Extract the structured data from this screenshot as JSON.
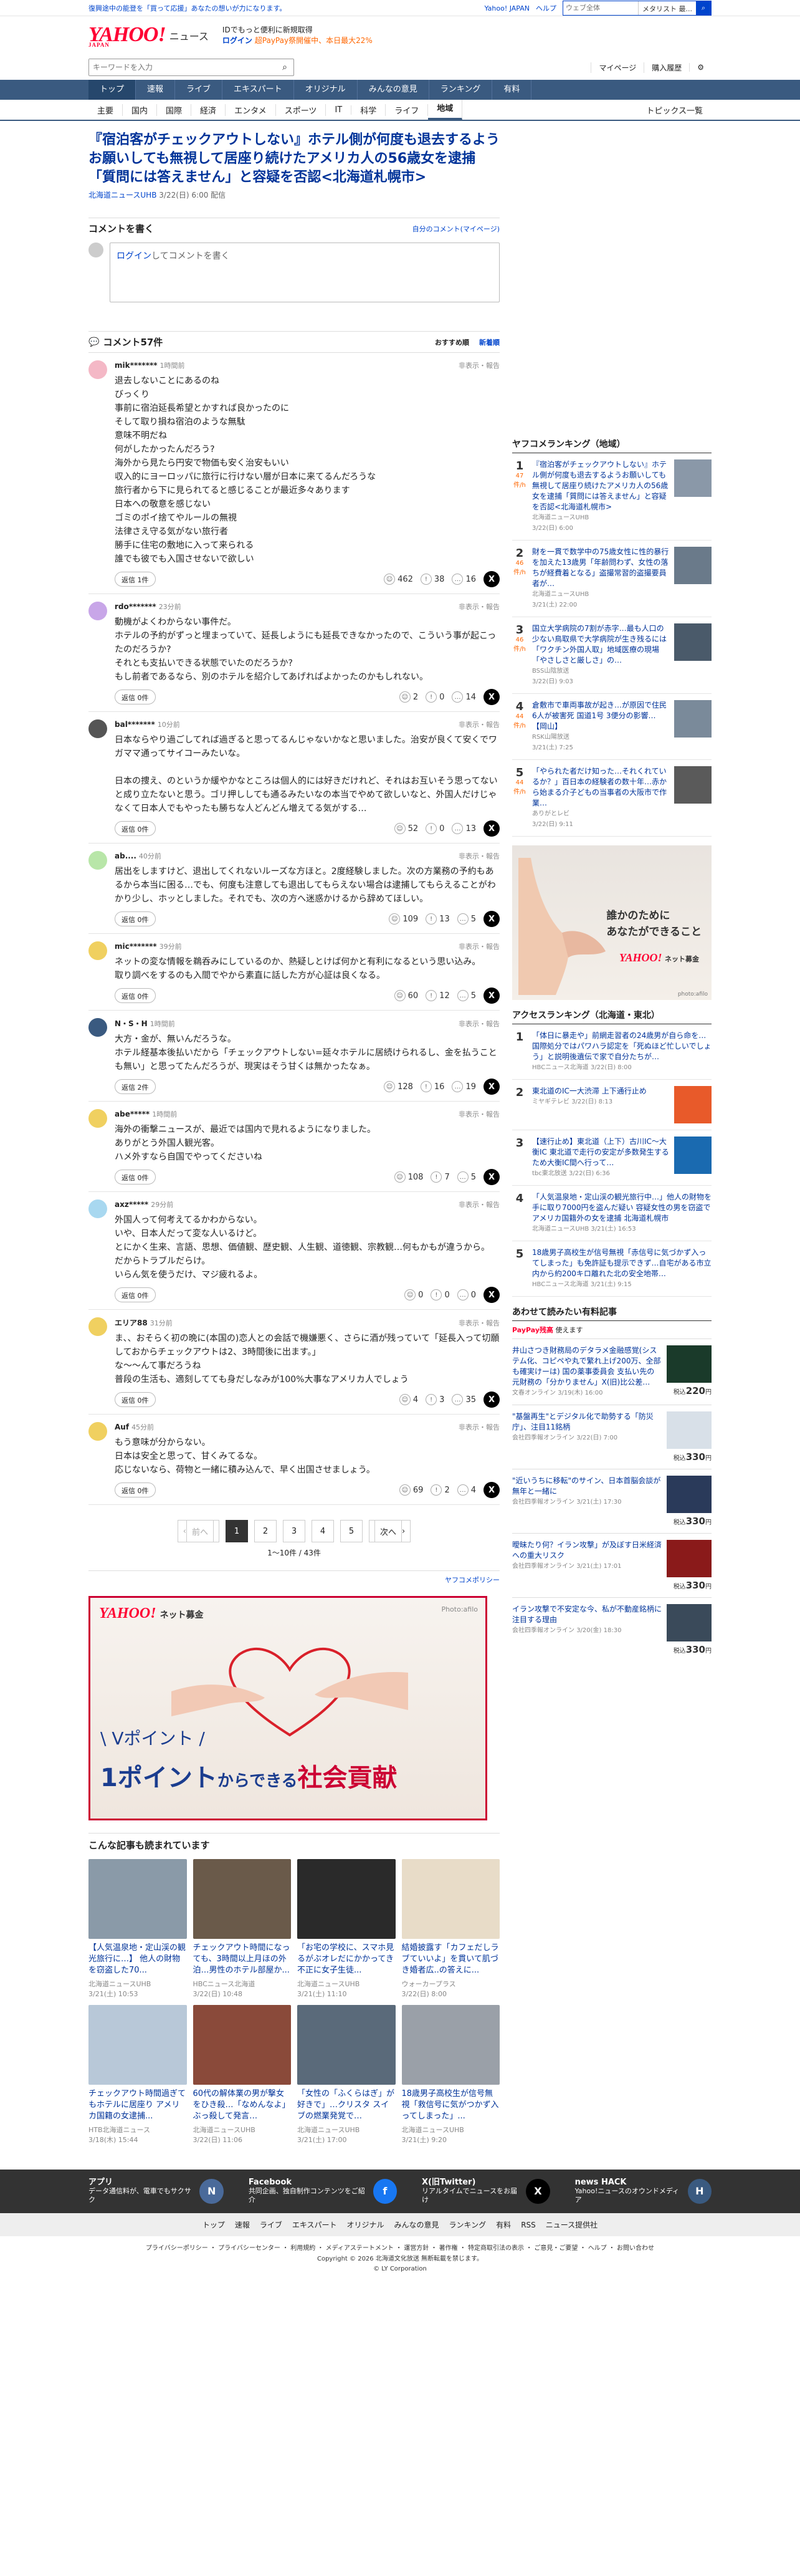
{
  "topbar": {
    "left": "復興途中の能登を「買って応援」あなたの想いが力になります。",
    "right_links": [
      "Yahoo! JAPAN",
      "ヘルプ"
    ],
    "search_placeholder": "キーワードを入力",
    "search_option": "ウェブ全体",
    "search_option2": "メタリスト 最..."
  },
  "header": {
    "logo": "YAHOO!",
    "logo_sub": "JAPAN",
    "service": "ニュース",
    "promo_line1": "IDでもっと便利に新規取得",
    "promo_line2": "ログイン",
    "promo_line3": "超PayPay祭開催中、本日最大22%"
  },
  "search": {
    "placeholder": "キーワードを入力",
    "usernav": [
      "マイページ",
      "購入履歴"
    ]
  },
  "gnav": [
    "トップ",
    "速報",
    "ライブ",
    "エキスパート",
    "オリジナル",
    "みんなの意見",
    "ランキング",
    "有料"
  ],
  "subnav": [
    "主要",
    "国内",
    "国際",
    "経済",
    "エンタメ",
    "スポーツ",
    "IT",
    "科学",
    "ライフ",
    "地域"
  ],
  "subnav_right": "トピックス一覧",
  "article": {
    "title": "『宿泊客がチェックアウトしない』ホテル側が何度も退去するようお願いしても無視して居座り続けたアメリカ人の56歳女を逮捕「質問には答えません」と容疑を否認<北海道札幌市>",
    "source": "北海道ニュースUHB",
    "date": "3/22(日) 6:00 配信"
  },
  "comment_form": {
    "heading": "コメントを書く",
    "mylink": "自分のコメント(マイページ)",
    "login": "ログイン",
    "placeholder": "してコメントを書く"
  },
  "comments_bar": {
    "count": "コメント57件",
    "sort": [
      "おすすめ順",
      "新着順"
    ]
  },
  "comments": [
    {
      "user": "mik*******",
      "time": "1時間前",
      "report": "非表示・報告",
      "text": "退去しないことにあるのね\nびっくり\n事前に宿泊延長希望とかすれば良かったのに\nそして取り損ね宿泊のような無駄\n意味不明だね\n何がしたかったんだろう?\n海外から見たら円安で物価も安く治安もいい\n収入的にヨーロッパに旅行に行けない層が日本に来てるんだろうな\n旅行者から下に見られてると感じることが最近多々あります\n日本への敬意を感じない\nゴミのポイ捨てやルールの無視\n法律さえ守る気がない旅行者\n勝手に住宅の敷地に入って来られる\n誰でも彼でも入国させないで欲しい",
      "reply": "返信 1件",
      "r1": "462",
      "r2": "38",
      "r3": "16",
      "avc": "#f4b8c6"
    },
    {
      "user": "rdo*******",
      "time": "23分前",
      "report": "非表示・報告",
      "text": "動機がよくわからない事件だ。\nホテルの予約がずっと埋まっていて、延長しようにも延長できなかったので、こういう事が起こったのだろうか?\nそれとも支払いできる状態でいたのだろうか?\nもし前者であるなら、別のホテルを紹介してあげればよかったのかもしれない。",
      "reply": "返信 0件",
      "r1": "2",
      "r2": "0",
      "r3": "14",
      "avc": "#c8a6e8"
    },
    {
      "user": "bal*******",
      "time": "10分前",
      "report": "非表示・報告",
      "text": "日本ならやり過ごしてれば過ぎると思ってるんじゃないかなと思いました。治安が良くて安くでワガママ通ってサイコーみたいな。\n\n日本の捜え、のというか緩やかなところは個人的には好きだけれど、それはお互いそう思ってないと成り立たないと思う。ゴリ押ししても通るみたいなの本当でやめて欲しいなと、外国人だけじゃなくて日本人でもやったも勝ちな人どんどん増えてる気がする…",
      "reply": "返信 0件",
      "r1": "52",
      "r2": "0",
      "r3": "13",
      "avc": "#555"
    },
    {
      "user": "ab....",
      "time": "40分前",
      "report": "非表示・報告",
      "text": "居出をしますけど、退出してくれないルーズな方ほと。2度経験しました。次の方業務の予約もあるから本当に困る…でも、何度も注意しても退出してもらえない場合は逮捕してもらえることがわかり少し、ホッとしました。それでも、次の方へ迷惑かけるから辞めてほしい。",
      "reply": "返信 0件",
      "r1": "109",
      "r2": "13",
      "r3": "5",
      "avc": "#b8e6a8"
    },
    {
      "user": "mic*******",
      "time": "39分前",
      "report": "非表示・報告",
      "text": "ネットの変な情報を鵜呑みにしているのか、熱疑しとけば何かと有利になるという思い込み。\n取り調べをするのも入間でやから素直に話した方が心証は良くなる。",
      "reply": "返信 0件",
      "r1": "60",
      "r2": "12",
      "r3": "5",
      "avc": "#f0d060"
    },
    {
      "user": "N・S・H",
      "time": "1時間前",
      "report": "非表示・報告",
      "text": "大方・金が、無いんだろうな。\nホテル経基本後払いだから「チェックアウトしない=延々ホテルに居続けられるし、金を払うことも無い」と思ってたんだろうが、現実はそう甘くは無かったなぁ。",
      "reply": "返信 2件",
      "r1": "128",
      "r2": "16",
      "r3": "19",
      "avc": "#3a5a80"
    },
    {
      "user": "abe*****",
      "time": "1時間前",
      "report": "非表示・報告",
      "text": "海外の衝撃ニュースが、最近では国内で見れるようになりました。\nありがとう外国人観光客。\nハメ外すなら自国でやってくださいね",
      "reply": "返信 0件",
      "r1": "108",
      "r2": "7",
      "r3": "5",
      "avc": "#f0d060"
    },
    {
      "user": "axz*****",
      "time": "29分前",
      "report": "非表示・報告",
      "text": "外国人って何考えてるかわからない。\nいや、日本人だって変な人いるけど。\nとにかく生来、言語、思想、価値観、歴史観、人生観、道徳観、宗教観…何もかもが違うから。\nだからトラブルだらけ。\nいらん気を使うだけ、マジ疲れるよ。",
      "reply": "返信 0件",
      "r1": "0",
      "r2": "0",
      "r3": "0",
      "avc": "#a8d8f0"
    },
    {
      "user": "エリア88",
      "time": "31分前",
      "report": "非表示・報告",
      "text": "ま、、おそらく初の晩に(本国の)恋人との会話で機嫌悪く、さらに酒が残っていて「延長入って切願しておからチェックアウトは2、3時間後に出ます。」\nな〜〜んて事だろうね\n普段の生活も、適刻してても身だしなみが100%大事なアメリカ人でしょう",
      "reply": "返信 0件",
      "r1": "4",
      "r2": "3",
      "r3": "35",
      "avc": "#f0d060"
    },
    {
      "user": "Auf",
      "time": "45分前",
      "report": "非表示・報告",
      "text": "もう意味が分からない。\n日本は安全と思って、甘くみてるな。\n応じないなら、荷物と一緒に積み込んで、早く出国させましょう。",
      "reply": "返信 0件",
      "r1": "69",
      "r2": "2",
      "r3": "4",
      "avc": "#f0d060"
    }
  ],
  "pager": {
    "prev": "前へ",
    "pages": [
      "1",
      "2",
      "3",
      "4",
      "5"
    ],
    "next": "次へ",
    "info": "1〜10件 / 43件"
  },
  "yahtc": "ヤフコメポリシー",
  "ad_main": {
    "brand": "YAHOO!",
    "brand_sub": "ネット募金",
    "photo": "Photo:afilo",
    "line1": "\\ Vポイント /",
    "line2a": "1ポイント",
    "line2b": "からできる",
    "line2c": "社会貢献"
  },
  "related": {
    "heading": "こんな記事も読まれています",
    "items": [
      {
        "title": "【人気温泉地・定山渓の観光旅行に…】 他人の財物を窃盗した70...",
        "src": "北海道ニュースUHB",
        "date": "3/21(土) 10:53",
        "c": "#8a9aa8"
      },
      {
        "title": "チェックアウト時間になっても、3時間以上月ほの外泊…男性のホテル部屋か...",
        "src": "HBCニュース北海道",
        "date": "3/22(日) 10:48",
        "c": "#6a5a4a"
      },
      {
        "title": "「お宅の学校に、スマホ見るがぶオレだにかかってき不正に女子生徒...",
        "src": "北海道ニュースUHB",
        "date": "3/21(土) 11:10",
        "c": "#2a2a2a"
      },
      {
        "title": "結婚披露す「カフェだしラブていいよ」を貫いて肌づき婚者広..の答えに...",
        "src": "ウォーカープラス",
        "date": "3/22(日) 8:00",
        "c": "#e8dcc8"
      },
      {
        "title": "チェックアウト時間過ぎてもホテルに居座り アメリカ国籍の女逮捕...",
        "src": "HTB北海道ニュース",
        "date": "3/18(木) 15:44",
        "c": "#b8c8d8"
      },
      {
        "title": "60代の解体業の男が撃女をひき殺…「なめんなよ」ぶっ殺して発言…",
        "src": "北海道ニュースUHB",
        "date": "3/22(日) 11:06",
        "c": "#8a4a3a"
      },
      {
        "title": "「女性の「ふくらはぎ」が好きで」…クリスタ スイブの燃業発覚で…",
        "src": "北海道ニュースUHB",
        "date": "3/21(土) 17:00",
        "c": "#5a6a7a"
      },
      {
        "title": "18歳男子高校生が信号無視「救信号に気がつかず入ってしまった」...",
        "src": "北海道ニュースUHB",
        "date": "3/21(土) 9:20",
        "c": "#9aa0a8"
      }
    ]
  },
  "ranking": {
    "heading": "ヤフコメランキング（地域）",
    "items": [
      {
        "no": "1",
        "cnt": "47",
        "cntu": "件/h",
        "title": "『宿泊客がチェックアウトしない』ホテル側が何度も退去するようお願いしても無視して居座り続けたアメリカ人の56歳女を逮捕「質問には答えません」と容疑を否認<北海道札幌市>",
        "src": "北海道ニュースUHB",
        "date": "3/22(日) 6:00",
        "c": "#8a98a8"
      },
      {
        "no": "2",
        "cnt": "46",
        "cntu": "件/h",
        "title": "財を一貫で数学中の75歳女性に性的暴行を加えた13歳男「年齢問わず、女性の落ちが経費着となる」盗撮常習的盗撮要員者が…",
        "src": "北海道ニュースUHB",
        "date": "3/21(土) 22:00",
        "c": "#6a7a8a"
      },
      {
        "no": "3",
        "cnt": "46",
        "cntu": "件/h",
        "title": "国立大学病院の7割が赤字…最も人口の少ない鳥取県で大学病院が生き残るには「ワクチン外国人取」地域医療の現場「やさしさと厳しさ」の…",
        "src": "BSS山陰放送",
        "date": "3/22(日) 9:03",
        "c": "#4a5a6a"
      },
      {
        "no": "4",
        "cnt": "44",
        "cntu": "件/h",
        "title": "倉敷市で車両事故が起き…が原因で住民6人が被害死 国道1号 3便分の影響…【岡山】",
        "src": "RSK山陽放送",
        "date": "3/21(土) 7:25",
        "c": "#7a8a9a"
      },
      {
        "no": "5",
        "cnt": "44",
        "cntu": "件/h",
        "title": "「やられた者だけ知った…それくれているか？」百日本の経験者の数十年…赤から始まる介子どもの当事者の大阪市で作業…",
        "src": "ありがとレビ",
        "date": "3/22(日) 9:11",
        "c": "#5a5a5a"
      }
    ]
  },
  "ad_side": {
    "text1": "誰かのために",
    "text2": "あなたができること",
    "brand": "YAHOO!",
    "brand_sub": "ネット募金",
    "photo": "photo:afilo"
  },
  "access": {
    "heading": "アクセスランキング（北海道・東北）",
    "items": [
      {
        "no": "1",
        "title": "「体日に暴走や」前網走習者の24歳男が自ら命を…国際処分ではパワハラ認定を「死ぬほど忙しいでしょう」と説明後遺伝で家で自分たちが…",
        "src": "HBCニュース北海道",
        "date": "3/22(日) 8:00",
        "c": "#fff"
      },
      {
        "no": "2",
        "title": "東北道のIC一大渋滞 上下通行止め",
        "src": "ミヤギテレビ",
        "date": "3/22(日) 8:13",
        "c": "#e85a2a"
      },
      {
        "no": "3",
        "title": "【速行止め】東北道（上下）古川IC〜大衡IC 東北道で走行の安定が多数発生するため大衡IC間へ行って…",
        "src": "tbc東北放送",
        "date": "3/22(日) 6:36",
        "c": "#1a6ab0"
      },
      {
        "no": "4",
        "title": "「人気温泉地・定山渓の観光旅行中…」他人の財物を手に取り7000円を盗んだ疑い 容疑女性の男を窃盗でアメリカ国籍外の女を逮捕 北海道札幌市",
        "src": "北海道ニュースUHB",
        "date": "3/21(土) 16:53",
        "c": "#fff"
      },
      {
        "no": "5",
        "title": "18歳男子高校生が信号無視「赤信号に気づかず入ってしまった」も免許証も提示できず…自宅がある市立内から約200キロ離れた北の安全地帯…",
        "src": "HBCニュース北海道",
        "date": "3/21(土) 9:15",
        "c": "#fff"
      }
    ]
  },
  "shopping": {
    "heading": "あわせて読みたい有料記事",
    "paypay": "PayPay残高",
    "paypay_sub": "使えます",
    "items": [
      {
        "title": "井山さつき財務局のデタラメ金融感覚(システム化、コピペや丸で繁れ上げ200万、全部も確実けーは) 国の薬事委員会 支払い先の元財務の「分かりません」X(旧)比公差…",
        "src": "文春オンライン",
        "date": "3/19(木) 16:00",
        "price": "220",
        "c": "#1a3a2a"
      },
      {
        "title": "\"基盤再生\"とデジタル化で助勢する「防災庁」、注目11銘柄",
        "src": "会社四季報オンライン",
        "date": "3/22(日) 7:00",
        "price": "330",
        "c": "#d8e0e8"
      },
      {
        "title": "\"近いうちに移転\"のサイン、日本首脳会談が無年と一緒に",
        "src": "会社四季報オンライン",
        "date": "3/21(土) 17:30",
        "price": "330",
        "c": "#2a3a5a"
      },
      {
        "title": "曖昧たり何？イラン攻撃」が及ぼす日米経済への重大リスク",
        "src": "会社四季報オンライン",
        "date": "3/21(土) 17:01",
        "price": "330",
        "c": "#8a1a1a"
      },
      {
        "title": "イラン攻撃で不安定な今、私が不動産銘柄に注目する理由",
        "src": "会社四季報オンライン",
        "date": "3/20(金) 18:30",
        "price": "330",
        "c": "#3a4a5a"
      }
    ]
  },
  "footer": {
    "apps": [
      {
        "t": "アプリ",
        "s": "データ通信料が、電車でもサクサク"
      },
      {
        "t": "Facebook",
        "s": "共同企画、独自制作コンテンツをご紹介"
      },
      {
        "t": "X(旧Twitter)",
        "s": "リアルタイムでニュースをお届け"
      },
      {
        "t": "news HACK",
        "s": "Yahoo!ニュースのオウンドメディア"
      }
    ],
    "nav": [
      "トップ",
      "速報",
      "ライブ",
      "エキスパート",
      "オリジナル",
      "みんなの意見",
      "ランキング",
      "有料",
      "RSS",
      "ニュース提供社"
    ],
    "links": "プライバシーポリシー ・ プライバシーセンター ・ 利用規約 ・ メディアステートメント ・ 運営方針 ・ 著作権 ・ 特定商取引法の表示 ・ ご意見・ご要望 ・ ヘルプ ・ お問い合わせ",
    "copy1": "Copyright © 2026 北海道文化放送 無断転載を禁じます。",
    "copy2": "© LY Corporation"
  },
  "colors": {
    "accent": "#3a5a80",
    "link": "#0044cc",
    "brand": "#ff0033"
  }
}
